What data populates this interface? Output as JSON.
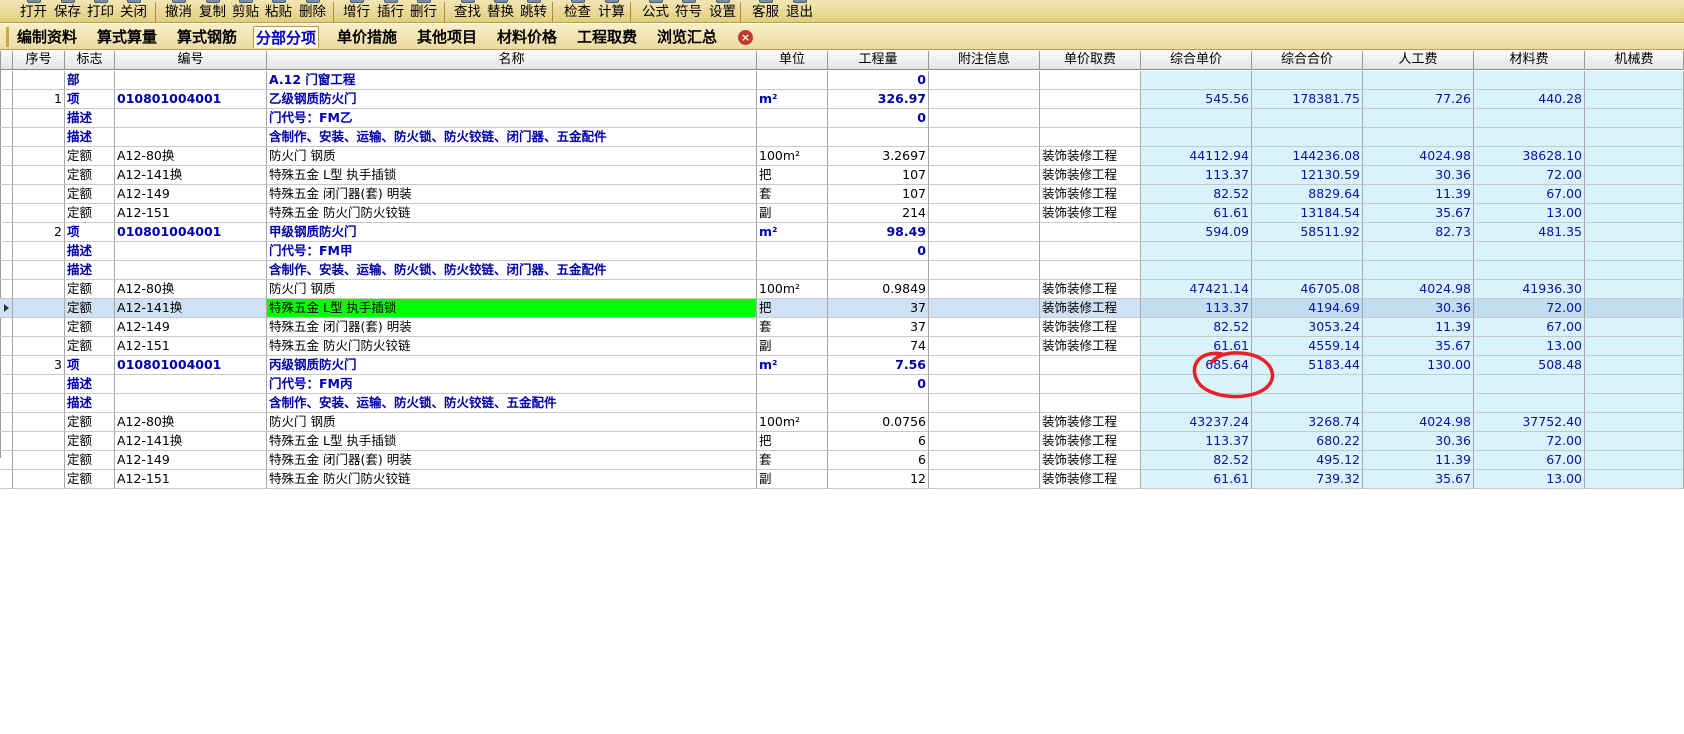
{
  "toolbar": {
    "buttons": [
      "打开",
      "保存",
      "打印",
      "关闭",
      "撤消",
      "复制",
      "剪贴",
      "粘贴",
      "删除",
      "增行",
      "插行",
      "删行",
      "查找",
      "替换",
      "跳转",
      "检查",
      "计算",
      "公式",
      "符号",
      "设置",
      "客服",
      "退出"
    ]
  },
  "tabs": {
    "items": [
      "编制资料",
      "算式算量",
      "算式钢筋",
      "分部分项",
      "单价措施",
      "其他项目",
      "材料价格",
      "工程取费",
      "浏览汇总"
    ],
    "active": "分部分项"
  },
  "table": {
    "columns": [
      "序号",
      "标志",
      "编号",
      "名称",
      "单位",
      "工程量",
      "附注信息",
      "单价取费",
      "综合单价",
      "综合合价",
      "人工费",
      "材料费",
      "机械费"
    ],
    "rows": [
      {
        "seq": "",
        "flag": "部",
        "code": "",
        "name": "A.12 门窗工程",
        "unit": "",
        "qty": "0",
        "note": "",
        "fee": "",
        "price": "",
        "total": "",
        "labor": "",
        "material": "",
        "bold": true
      },
      {
        "seq": "1",
        "flag": "项",
        "code": "010801004001",
        "name": "乙级钢质防火门",
        "unit": "m²",
        "qty": "326.97",
        "note": "",
        "fee": "",
        "price": "545.56",
        "total": "178381.75",
        "labor": "77.26",
        "material": "440.28",
        "bold": true
      },
      {
        "seq": "",
        "flag": "描述",
        "code": "",
        "name": "门代号：FM乙",
        "unit": "",
        "qty": "0",
        "note": "",
        "fee": "",
        "price": "",
        "total": "",
        "labor": "",
        "material": "",
        "bold": true
      },
      {
        "seq": "",
        "flag": "描述",
        "code": "",
        "name": "含制作、安装、运输、防火锁、防火铰链、闭门器、五金配件",
        "unit": "",
        "qty": "",
        "note": "",
        "fee": "",
        "price": "",
        "total": "",
        "labor": "",
        "material": "",
        "bold": true
      },
      {
        "seq": "",
        "flag": "定额",
        "code": "A12-80换",
        "name": "防火门 钢质",
        "unit": "100m²",
        "qty": "3.2697",
        "note": "",
        "fee": "装饰装修工程",
        "price": "44112.94",
        "total": "144236.08",
        "labor": "4024.98",
        "material": "38628.10"
      },
      {
        "seq": "",
        "flag": "定额",
        "code": "A12-141换",
        "name": "特殊五金 L型 执手插锁",
        "unit": "把",
        "qty": "107",
        "note": "",
        "fee": "装饰装修工程",
        "price": "113.37",
        "total": "12130.59",
        "labor": "30.36",
        "material": "72.00"
      },
      {
        "seq": "",
        "flag": "定额",
        "code": "A12-149",
        "name": "特殊五金 闭门器(套) 明装",
        "unit": "套",
        "qty": "107",
        "note": "",
        "fee": "装饰装修工程",
        "price": "82.52",
        "total": "8829.64",
        "labor": "11.39",
        "material": "67.00"
      },
      {
        "seq": "",
        "flag": "定额",
        "code": "A12-151",
        "name": "特殊五金 防火门防火铰链",
        "unit": "副",
        "qty": "214",
        "note": "",
        "fee": "装饰装修工程",
        "price": "61.61",
        "total": "13184.54",
        "labor": "35.67",
        "material": "13.00"
      },
      {
        "seq": "2",
        "flag": "项",
        "code": "010801004001",
        "name": "甲级钢质防火门",
        "unit": "m²",
        "qty": "98.49",
        "note": "",
        "fee": "",
        "price": "594.09",
        "total": "58511.92",
        "labor": "82.73",
        "material": "481.35",
        "bold": true
      },
      {
        "seq": "",
        "flag": "描述",
        "code": "",
        "name": "门代号：FM甲",
        "unit": "",
        "qty": "0",
        "note": "",
        "fee": "",
        "price": "",
        "total": "",
        "labor": "",
        "material": "",
        "bold": true
      },
      {
        "seq": "",
        "flag": "描述",
        "code": "",
        "name": "含制作、安装、运输、防火锁、防火铰链、闭门器、五金配件",
        "unit": "",
        "qty": "",
        "note": "",
        "fee": "",
        "price": "",
        "total": "",
        "labor": "",
        "material": "",
        "bold": true
      },
      {
        "seq": "",
        "flag": "定额",
        "code": "A12-80换",
        "name": "防火门 钢质",
        "unit": "100m²",
        "qty": "0.9849",
        "note": "",
        "fee": "装饰装修工程",
        "price": "47421.14",
        "total": "46705.08",
        "labor": "4024.98",
        "material": "41936.30"
      },
      {
        "seq": "",
        "flag": "定额",
        "code": "A12-141换",
        "name": "特殊五金 L型 执手插锁",
        "unit": "把",
        "qty": "37",
        "note": "",
        "fee": "装饰装修工程",
        "price": "113.37",
        "total": "4194.69",
        "labor": "30.36",
        "material": "72.00",
        "selected": true
      },
      {
        "seq": "",
        "flag": "定额",
        "code": "A12-149",
        "name": "特殊五金 闭门器(套) 明装",
        "unit": "套",
        "qty": "37",
        "note": "",
        "fee": "装饰装修工程",
        "price": "82.52",
        "total": "3053.24",
        "labor": "11.39",
        "material": "67.00"
      },
      {
        "seq": "",
        "flag": "定额",
        "code": "A12-151",
        "name": "特殊五金 防火门防火铰链",
        "unit": "副",
        "qty": "74",
        "note": "",
        "fee": "装饰装修工程",
        "price": "61.61",
        "total": "4559.14",
        "labor": "35.67",
        "material": "13.00"
      },
      {
        "seq": "3",
        "flag": "项",
        "code": "010801004001",
        "name": "丙级钢质防火门",
        "unit": "m²",
        "qty": "7.56",
        "note": "",
        "fee": "",
        "price": "685.64",
        "total": "5183.44",
        "labor": "130.00",
        "material": "508.48",
        "bold": true
      },
      {
        "seq": "",
        "flag": "描述",
        "code": "",
        "name": "门代号：FM丙",
        "unit": "",
        "qty": "0",
        "note": "",
        "fee": "",
        "price": "",
        "total": "",
        "labor": "",
        "material": "",
        "bold": true
      },
      {
        "seq": "",
        "flag": "描述",
        "code": "",
        "name": "含制作、安装、运输、防火锁、防火铰链、五金配件",
        "unit": "",
        "qty": "",
        "note": "",
        "fee": "",
        "price": "",
        "total": "",
        "labor": "",
        "material": "",
        "bold": true
      },
      {
        "seq": "",
        "flag": "定额",
        "code": "A12-80换",
        "name": "防火门 钢质",
        "unit": "100m²",
        "qty": "0.0756",
        "note": "",
        "fee": "装饰装修工程",
        "price": "43237.24",
        "total": "3268.74",
        "labor": "4024.98",
        "material": "37752.40"
      },
      {
        "seq": "",
        "flag": "定额",
        "code": "A12-141换",
        "name": "特殊五金 L型 执手插锁",
        "unit": "把",
        "qty": "6",
        "note": "",
        "fee": "装饰装修工程",
        "price": "113.37",
        "total": "680.22",
        "labor": "30.36",
        "material": "72.00"
      },
      {
        "seq": "",
        "flag": "定额",
        "code": "A12-149",
        "name": "特殊五金 闭门器(套) 明装",
        "unit": "套",
        "qty": "6",
        "note": "",
        "fee": "装饰装修工程",
        "price": "82.52",
        "total": "495.12",
        "labor": "11.39",
        "material": "67.00"
      },
      {
        "seq": "",
        "flag": "定额",
        "code": "A12-151",
        "name": "特殊五金 防火门防火铰链",
        "unit": "副",
        "qty": "12",
        "note": "",
        "fee": "装饰装修工程",
        "price": "61.61",
        "total": "739.32",
        "labor": "35.67",
        "material": "13.00"
      }
    ]
  },
  "colors": {
    "toolbar_bg": "#e8d48a",
    "active_tab_text": "#0000cc",
    "calc_column_bg": "#d8f3fb",
    "highlight_cell": "#00ff00",
    "selected_row": "#cfe2f3",
    "annotation": "#e8202a"
  },
  "icons": {
    "tab_close": "close-circle-icon",
    "row_pointer": "row-pointer-icon"
  }
}
